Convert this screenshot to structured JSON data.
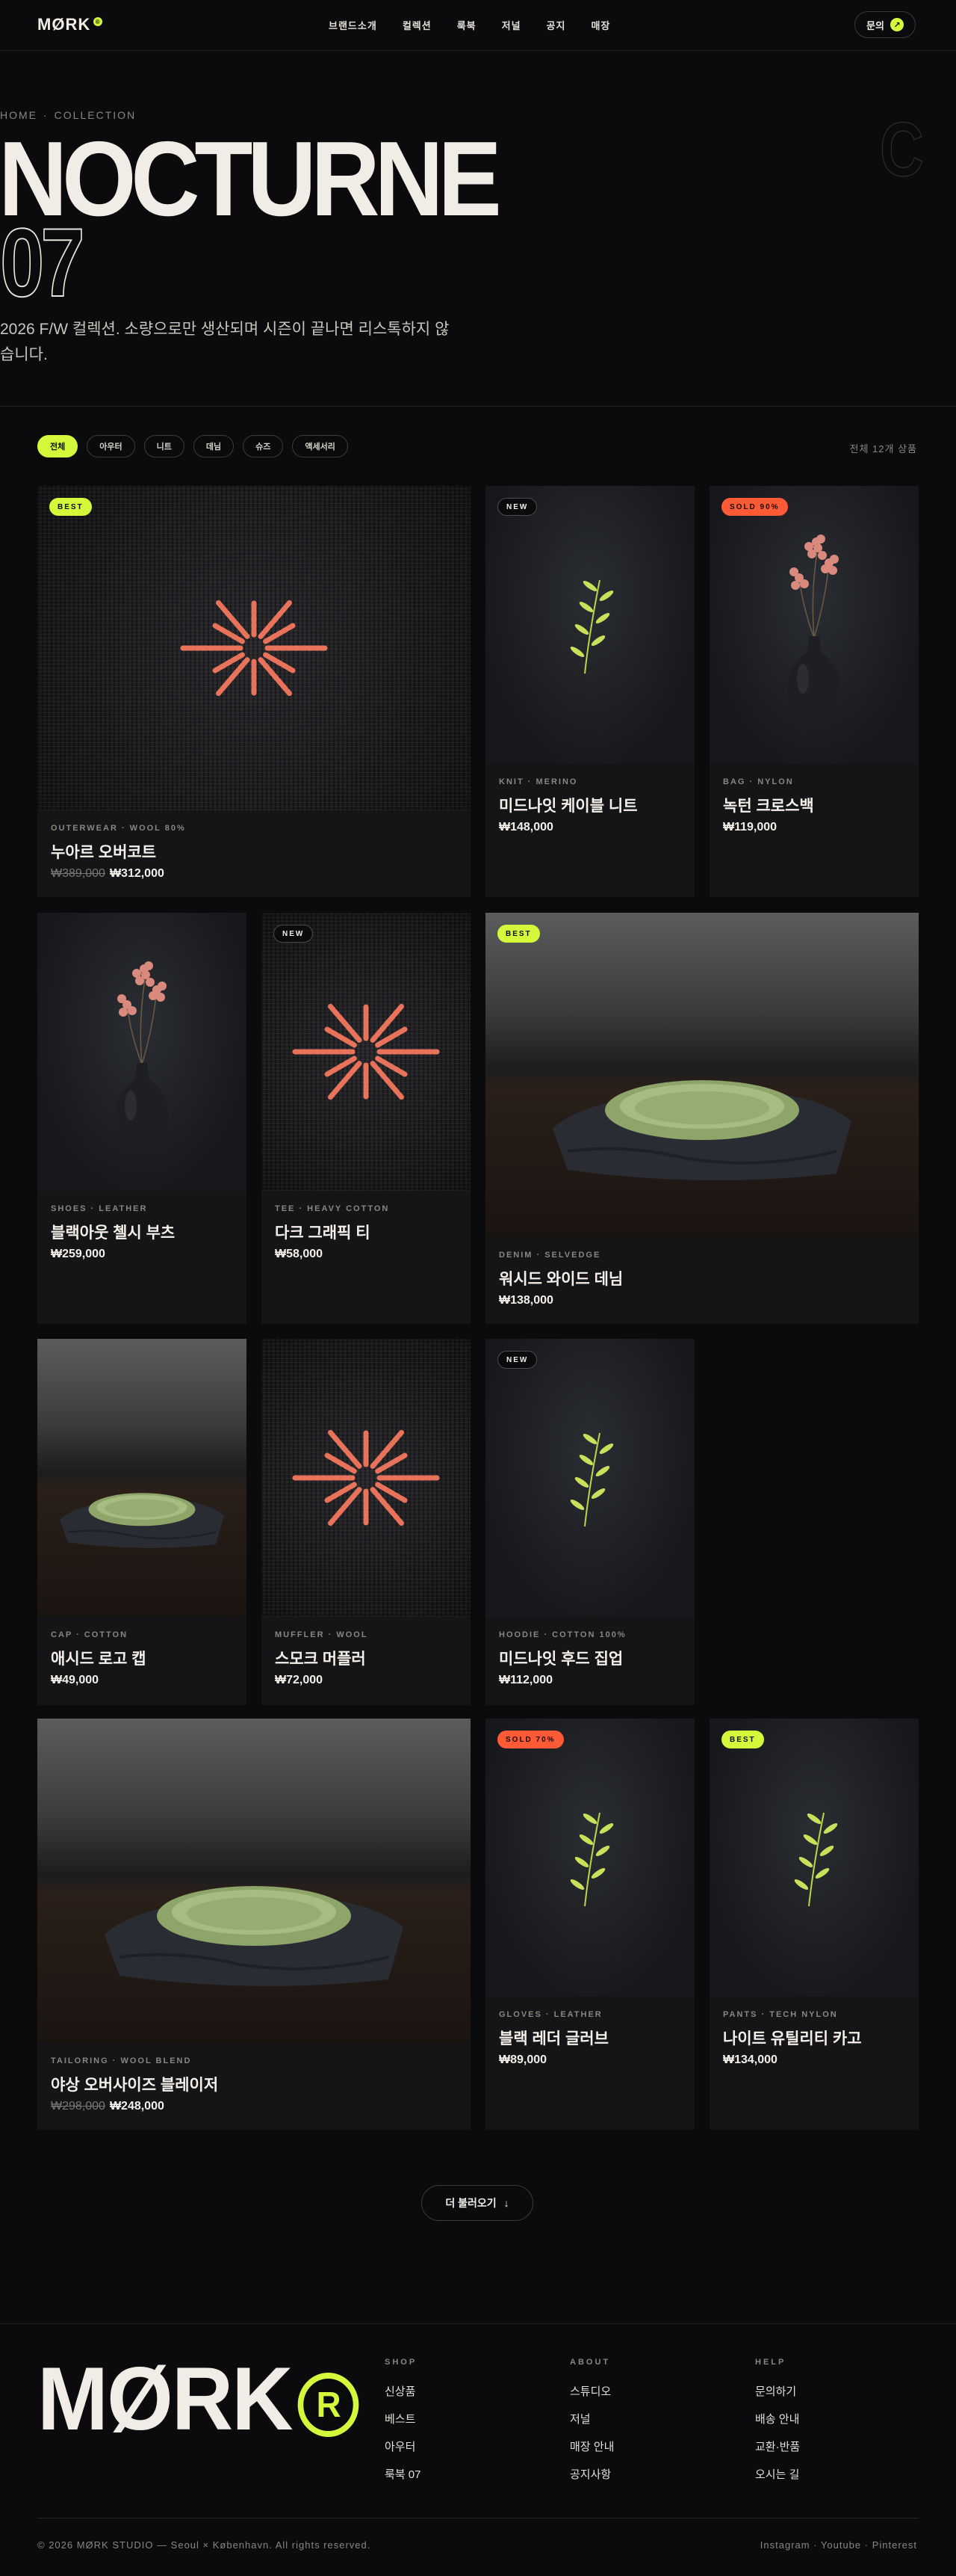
{
  "header": {
    "logo": "MØRK",
    "logo_mark": "®",
    "nav": [
      "브랜드소개",
      "컬렉션",
      "룩북",
      "저널",
      "공지",
      "매장"
    ],
    "contact_label": "문의",
    "contact_icon": "arrow-up-right-icon"
  },
  "hero": {
    "breadcrumb": [
      "HOME",
      "COLLECTION"
    ],
    "title_line1": "NOCTURNE",
    "title_line2": "07",
    "ghost_letter": "C",
    "subtitle": "2026 F/W 컬렉션. 소량으로만 생산되며 시즌이 끝나면 리스톡하지 않습니다."
  },
  "filters": {
    "chips": [
      "전체",
      "아우터",
      "니트",
      "데님",
      "슈즈",
      "액세서리"
    ],
    "active": 0,
    "count": "전체 12개 상품"
  },
  "products": [
    {
      "badge": "BEST",
      "meta": "OUTERWEAR · WOOL 80%",
      "name": "누아르 오버코트",
      "old_price": "₩389,000",
      "price": "₩312,000"
    },
    {
      "badge": "NEW",
      "meta": "KNIT · MERINO",
      "name": "미드나잇 케이블 니트",
      "old_price": "",
      "price": "₩148,000"
    },
    {
      "badge": "SOLD 90%",
      "meta": "BAG · NYLON",
      "name": "녹턴 크로스백",
      "old_price": "",
      "price": "₩119,000"
    },
    {
      "badge": "",
      "meta": "SHOES · LEATHER",
      "name": "블랙아웃 첼시 부츠",
      "old_price": "",
      "price": "₩259,000"
    },
    {
      "badge": "NEW",
      "meta": "TEE · HEAVY COTTON",
      "name": "다크 그래픽 티",
      "old_price": "",
      "price": "₩58,000"
    },
    {
      "badge": "BEST",
      "meta": "DENIM · SELVEDGE",
      "name": "워시드 와이드 데님",
      "old_price": "",
      "price": "₩138,000"
    },
    {
      "badge": "",
      "meta": "CAP · COTTON",
      "name": "애시드 로고 캡",
      "old_price": "",
      "price": "₩49,000"
    },
    {
      "badge": "",
      "meta": "MUFFLER · WOOL",
      "name": "스모크 머플러",
      "old_price": "",
      "price": "₩72,000"
    },
    {
      "badge": "NEW",
      "meta": "HOODIE · COTTON 100%",
      "name": "미드나잇 후드 집업",
      "old_price": "",
      "price": "₩112,000"
    },
    {
      "badge": "",
      "meta": "TAILORING · WOOL BLEND",
      "name": "야상 오버사이즈 블레이저",
      "old_price": "₩298,000",
      "price": "₩248,000"
    },
    {
      "badge": "SOLD 70%",
      "meta": "GLOVES · LEATHER",
      "name": "블랙 레더 글러브",
      "old_price": "",
      "price": "₩89,000"
    },
    {
      "badge": "BEST",
      "meta": "PANTS · TECH NYLON",
      "name": "나이트 유틸리티 카고",
      "old_price": "",
      "price": "₩134,000"
    }
  ],
  "load_more": {
    "label": "더 불러오기",
    "icon": "arrow-down-icon"
  },
  "footer": {
    "logo": "MØRK",
    "logo_mark": "R",
    "columns": [
      {
        "title": "SHOP",
        "links": [
          "신상품",
          "베스트",
          "아우터",
          "룩북 07"
        ]
      },
      {
        "title": "ABOUT",
        "links": [
          "스튜디오",
          "저널",
          "매장 안내",
          "공지사항"
        ]
      },
      {
        "title": "HELP",
        "links": [
          "문의하기",
          "배송 안내",
          "교환·반품",
          "오시는 길"
        ]
      }
    ],
    "copyright": "© 2026 MØRK STUDIO — Seoul × København. All rights reserved.",
    "social": "Instagram · Youtube · Pinterest"
  },
  "colors": {
    "accent": "#d4f93a",
    "sold": "#ff5a36",
    "bg": "#0b0b0d",
    "card": "#151518"
  }
}
